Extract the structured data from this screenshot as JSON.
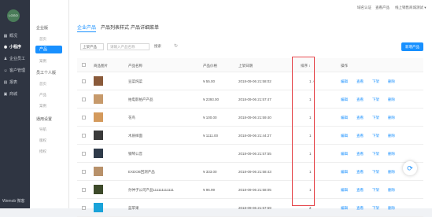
{
  "sidebar": {
    "logo": "LOGO",
    "items": [
      {
        "icon": "chart-icon",
        "glyph": "▦",
        "label": "概况"
      },
      {
        "icon": "miniprogram-icon",
        "glyph": "◉",
        "label": "小程序"
      },
      {
        "icon": "staff-icon",
        "glyph": "♟",
        "label": "企业员工"
      },
      {
        "icon": "customer-icon",
        "glyph": "☺",
        "label": "客户管理"
      },
      {
        "icon": "data-icon",
        "glyph": "▤",
        "label": "报表"
      },
      {
        "icon": "shop-icon",
        "glyph": "▣",
        "label": "商城"
      }
    ],
    "footer": "Wemob 微客"
  },
  "subnav": {
    "group1": "企业版",
    "group1_items": [
      "首页"
    ],
    "active": "产品",
    "group1_more": [
      "案例"
    ],
    "group2": "员工个人版",
    "group2_items": [
      "首页",
      "产品",
      "案例"
    ],
    "group3": "通用设置",
    "group3_items": [
      "导航",
      "版权",
      "授权"
    ]
  },
  "topbar": {
    "links": [
      "域名认证",
      "查看产品",
      "线上销售商城测试 ▾"
    ]
  },
  "tabs": [
    "企业产品",
    "产品列表样式",
    "产品详细菜单"
  ],
  "toolbar": {
    "select_value": "上架产品",
    "search_placeholder": "请输入产品名称",
    "search_label": "搜索",
    "refresh_glyph": "↻",
    "new_label": "新增产品"
  },
  "table": {
    "headers": [
      "商品图片",
      "产品名称",
      "产品价格",
      "上架日期",
      "排序 ↕",
      "操作"
    ],
    "rows": [
      {
        "thumb": "#8a5a3a",
        "name": "豆菜炖菜",
        "price": "¥ 55.00",
        "date": "2018-09-06 21:58:02",
        "sort": "1 ↗"
      },
      {
        "thumb": "#c79a6b",
        "name": "拍电影拍产产品",
        "price": "¥ 2393.00",
        "date": "2018-09-06 21:57:47",
        "sort": "1"
      },
      {
        "thumb": "#d49a5c",
        "name": "花鸟",
        "price": "¥ 100.00",
        "date": "2018-09-06 21:59:40",
        "sort": "1"
      },
      {
        "thumb": "#3a3a3a",
        "name": "木质样面",
        "price": "¥ 1111.00",
        "date": "2018-09-06 21:44:27",
        "sort": "1"
      },
      {
        "thumb": "#2f3b4a",
        "name": "钢琴公音",
        "price": "",
        "date": "2018-09-06 21:57:55",
        "sort": "1"
      },
      {
        "thumb": "#b8916a",
        "name": "EXDOB回测产品",
        "price": "¥ 333.00",
        "date": "2018-09-06 21:58:43",
        "sort": "1"
      },
      {
        "thumb": "#3d4a2a",
        "name": "孙仲子公司产品111111111111",
        "price": "¥ 96.99",
        "date": "2018-09-06 21:58:05",
        "sort": "1"
      },
      {
        "thumb": "#1aa3d9",
        "name": "蓝苹果",
        "price": "",
        "date": "2018-09-06 21:57:59",
        "sort": "2"
      }
    ],
    "actions": [
      "编辑",
      "查看",
      "下架",
      "删除"
    ]
  },
  "float": {
    "glyph": "⟳"
  },
  "colors": {
    "accent": "#1890ff",
    "highlight": "#e5484d",
    "sidebar_bg": "#2f3542"
  }
}
